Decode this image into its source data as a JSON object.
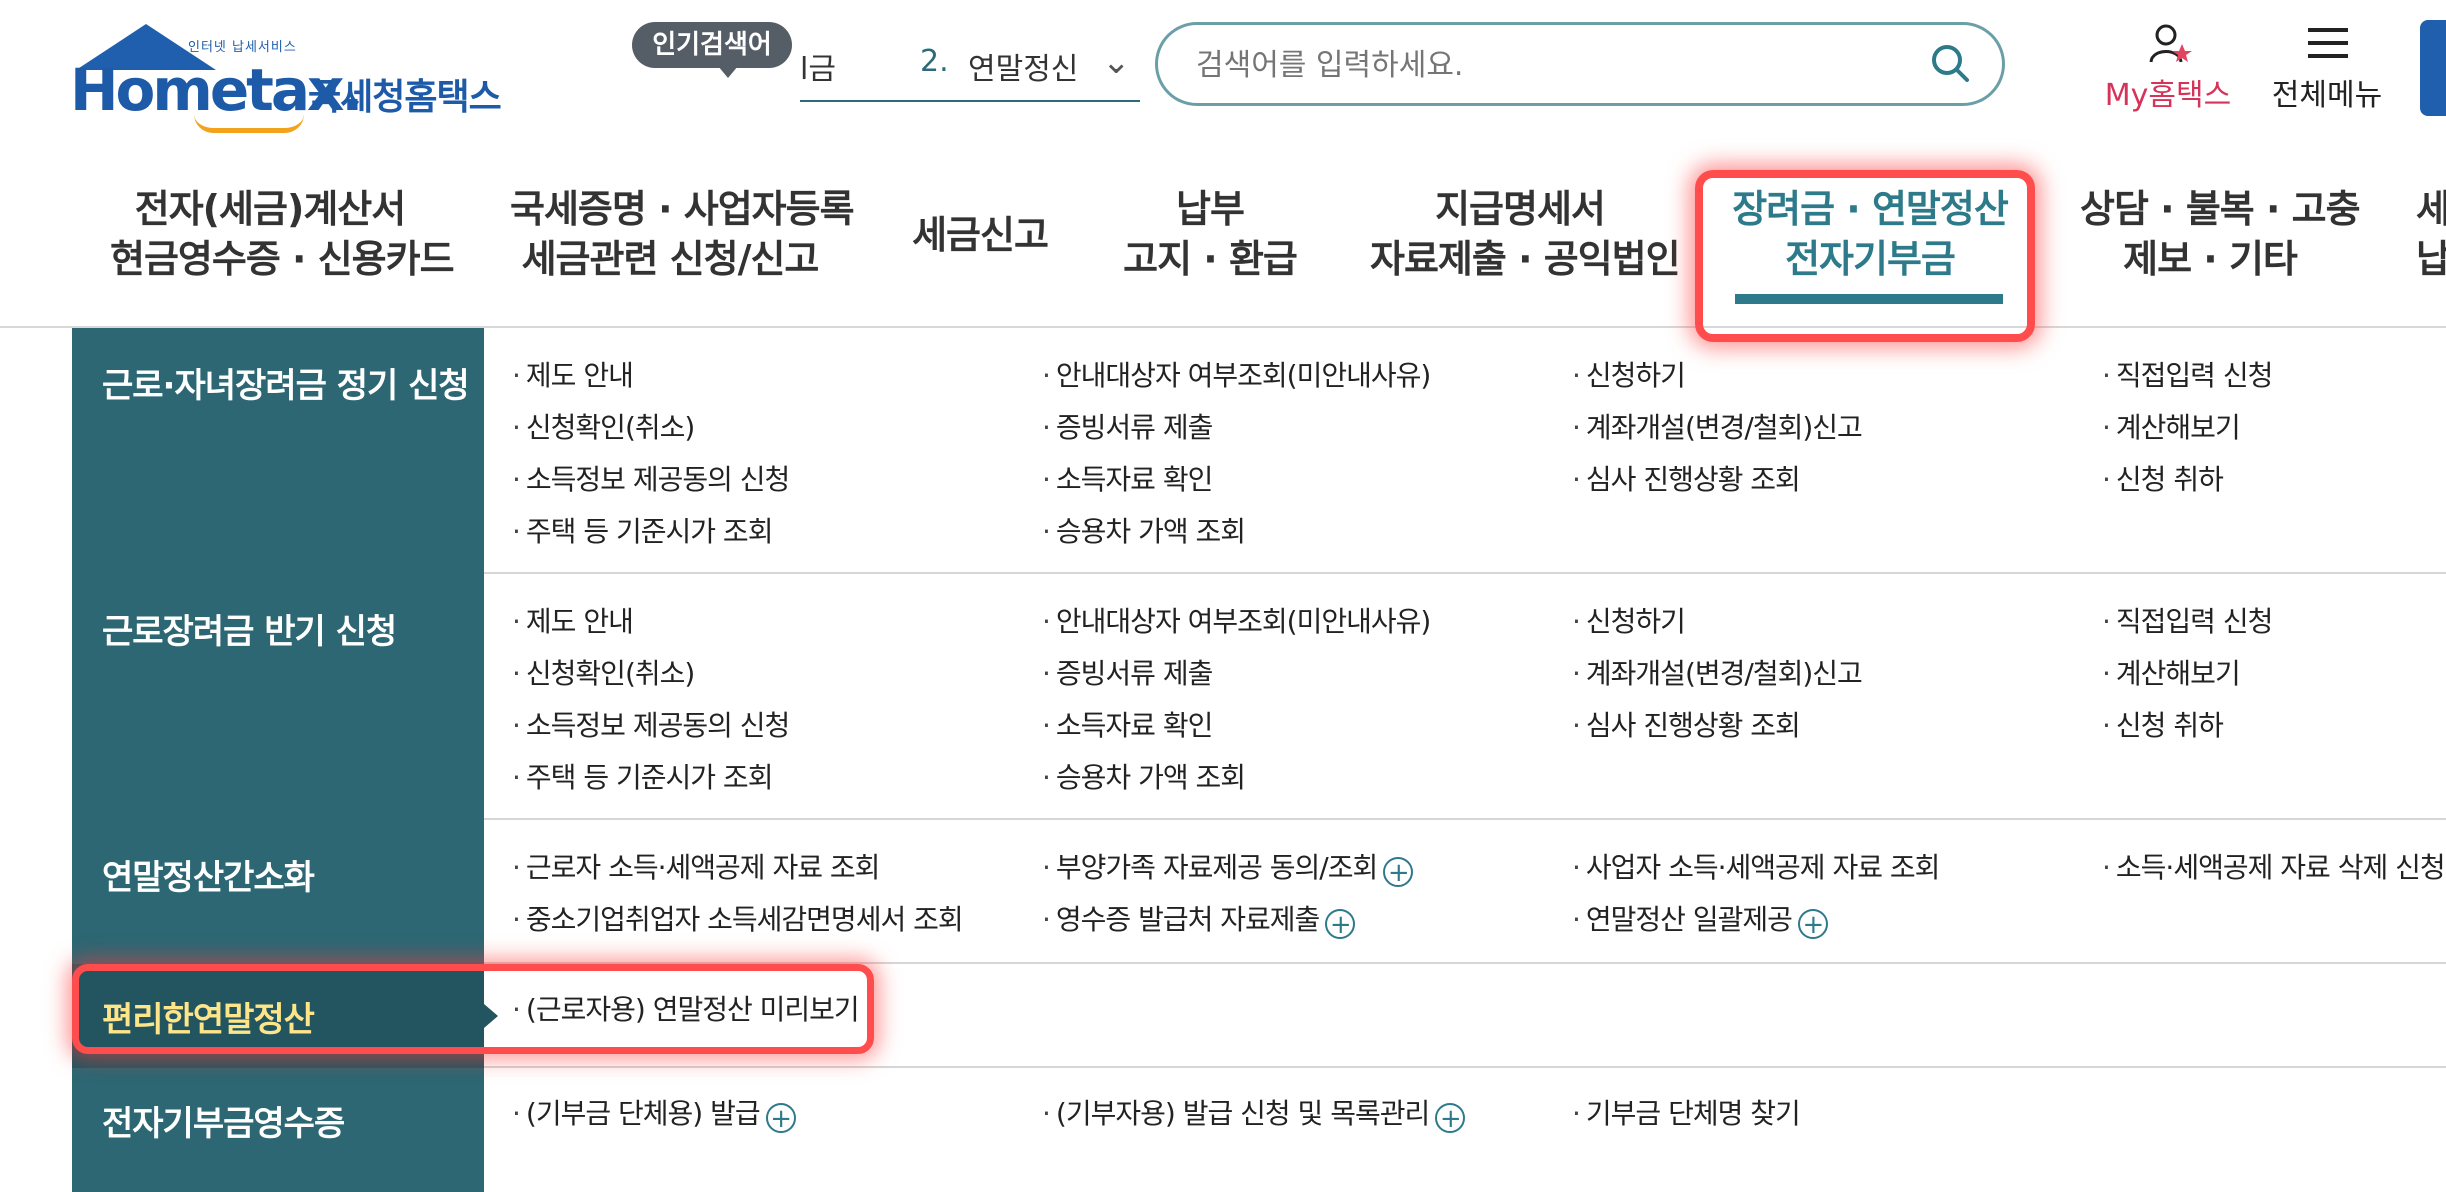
{
  "header": {
    "logo_small": "인터넷 납세서비스",
    "logo_main": "Hometax.",
    "logo_kr": "국세청홈택스",
    "popular_label": "인기검색어",
    "popular_prev": "l금",
    "popular_rank": "2.",
    "popular_term": "연말정신",
    "search_placeholder": "검색어를 입력하세요.",
    "my_label": "My홈택스",
    "all_menu_label": "전체메뉴"
  },
  "gnb": [
    {
      "line1": "전자(세금)계산서",
      "line2": "현금영수증 · 신용카드"
    },
    {
      "line1": "국세증명 · 사업자등록",
      "line2": "세금관련 신청/신고"
    },
    {
      "line1": "세금신고",
      "line2": ""
    },
    {
      "line1": "납부",
      "line2": "고지 · 환급"
    },
    {
      "line1": "지급명세서",
      "line2": "자료제출 · 공익법인"
    },
    {
      "line1": "장려금 · 연말정산",
      "line2": "전자기부금"
    },
    {
      "line1": "상담 · 불복 · 고충",
      "line2": "제보 · 기타"
    },
    {
      "line1": "세",
      "line2": "납"
    }
  ],
  "sections": [
    {
      "title": "근로·자녀장려금 정기 신청",
      "links": [
        [
          "제도 안내",
          "안내대상자 여부조회(미안내사유)",
          "신청하기",
          "직접입력 신청"
        ],
        [
          "신청확인(취소)",
          "증빙서류 제출",
          "계좌개설(변경/철회)신고",
          "계산해보기"
        ],
        [
          "소득정보 제공동의 신청",
          "소득자료 확인",
          "심사 진행상황 조회",
          "신청 취하"
        ],
        [
          "주택 등 기준시가 조회",
          "승용차 가액 조회",
          "",
          ""
        ]
      ]
    },
    {
      "title": "근로장려금 반기 신청",
      "links": [
        [
          "제도 안내",
          "안내대상자 여부조회(미안내사유)",
          "신청하기",
          "직접입력 신청"
        ],
        [
          "신청확인(취소)",
          "증빙서류 제출",
          "계좌개설(변경/철회)신고",
          "계산해보기"
        ],
        [
          "소득정보 제공동의 신청",
          "소득자료 확인",
          "심사 진행상황 조회",
          "신청 취하"
        ],
        [
          "주택 등 기준시가 조회",
          "승용차 가액 조회",
          "",
          ""
        ]
      ]
    },
    {
      "title": "연말정산간소화",
      "links": [
        [
          "근로자 소득·세액공제 자료 조회",
          "부양가족 자료제공 동의/조회",
          "사업자 소득·세액공제 자료 조회",
          "소득·세액공제 자료 삭제 신청"
        ],
        [
          "중소기업취업자 소득세감면명세서 조회",
          "영수증 발급처 자료제출",
          "연말정산 일괄제공",
          ""
        ]
      ]
    },
    {
      "title": "편리한연말정산",
      "links": [
        [
          "(근로자용) 연말정산 미리보기",
          "",
          "",
          ""
        ]
      ]
    },
    {
      "title": "전자기부금영수증",
      "links": [
        [
          "(기부금 단체용) 발급",
          "(기부자용) 발급 신청 및 목록관리",
          "기부금 단체명 찾기",
          ""
        ]
      ]
    }
  ],
  "colors": {
    "accent": "#2d7a8a",
    "category_bg": "#2c6773",
    "highlight": "#ff4d4d",
    "my_label": "#d6335a"
  }
}
